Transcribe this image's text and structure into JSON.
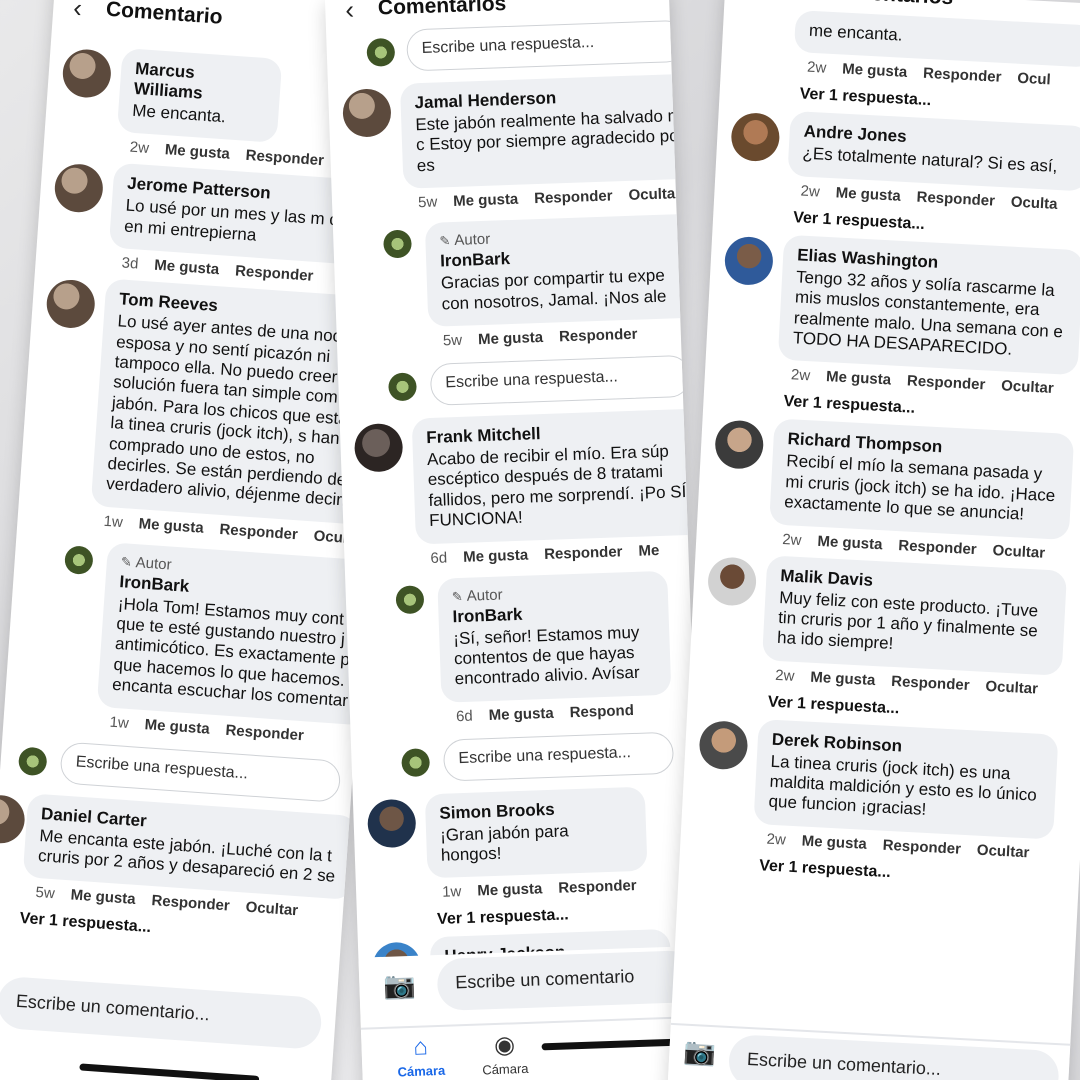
{
  "panel1": {
    "title": "Comentario",
    "comments": [
      {
        "name": "Marcus Williams",
        "text": "Me encanta.",
        "time": "2w",
        "like": "Me gusta",
        "reply": "Responder"
      },
      {
        "name": "Jerome Patterson",
        "text": "Lo usé por un mes y las m oscuras en mi entrepierna",
        "time": "3d",
        "like": "Me gusta",
        "reply": "Responder"
      },
      {
        "name": "Tom Reeves",
        "text": "Lo usé ayer antes de una noc esposa y no sentí picazón ni tampoco ella. No puedo creer solución fuera tan simple com jabón. Para los chicos que esta con la tinea cruris (jock itch), s han comprado uno de estos, no decirles. Se están perdiendo de verdadero alivio, déjenme decirl",
        "time": "1w",
        "like": "Me gusta",
        "reply": "Responder",
        "hide": "Ocult"
      }
    ],
    "author_reply": {
      "badge": "Autor",
      "name": "IronBark",
      "text": "¡Hola Tom! Estamos muy cont que te esté gustando nuestro j antimicótico. Es exactamente p que hacemos lo que hacemos. encanta escuchar los comentar",
      "time": "1w",
      "like": "Me gusta",
      "reply": "Responder"
    },
    "reply_placeholder": "Escribe una respuesta...",
    "last_comment": {
      "name": "Daniel Carter",
      "text": "Me encanta este jabón. ¡Luché con la t cruris por 2 años y desapareció en 2 se",
      "time": "5w",
      "like": "Me gusta",
      "reply": "Responder",
      "hide": "Ocultar"
    },
    "view_reply": "Ver 1 respuesta...",
    "comment_placeholder": "Escribe un comentario..."
  },
  "panel2": {
    "title": "Comentarios",
    "reply_placeholder": "Escribe una respuesta...",
    "comments": [
      {
        "name": "Jamal Henderson",
        "text": "Este jabón realmente ha salvado mi c Estoy por siempre agradecido por es",
        "time": "5w",
        "like": "Me gusta",
        "reply": "Responder",
        "hide": "Ocultar"
      },
      {
        "name": "Frank Mitchell",
        "text": "Acabo de recibir el mío. Era súp escéptico después de 8 tratami fallidos, pero me sorprendí. ¡Po SÍ FUNCIONA!",
        "time": "6d",
        "like": "Me gusta",
        "reply": "Responder",
        "hide": "Me"
      },
      {
        "name": "Simon Brooks",
        "text": "¡Gran jabón para hongos!",
        "time": "1w",
        "like": "Me gusta",
        "reply": "Responder"
      },
      {
        "name": "Henry Jackson",
        "text": ""
      }
    ],
    "author_replies": [
      {
        "badge": "Autor",
        "name": "IronBark",
        "text": "Gracias por compartir tu expe con nosotros, Jamal. ¡Nos ale",
        "time": "5w",
        "like": "Me gusta",
        "reply": "Responder"
      },
      {
        "badge": "Autor",
        "name": "IronBark",
        "text": "¡Sí, señor! Estamos muy contentos de que hayas encontrado alivio. Avísar",
        "time": "6d",
        "like": "Me gusta",
        "reply": "Respond"
      }
    ],
    "view_reply": "Ver 1 respuesta...",
    "comment_placeholder": "Escribe un comentario",
    "tabs": [
      {
        "label": "Cámara",
        "icon": "home-icon"
      },
      {
        "label": "Cámara",
        "icon": "profile-icon"
      }
    ]
  },
  "panel3": {
    "title": "Comentarios",
    "top_text": "me encanta.",
    "top_time": "2w",
    "top_like": "Me gusta",
    "top_reply": "Responder",
    "top_hide": "Ocul",
    "view_reply": "Ver 1 respuesta...",
    "comments": [
      {
        "name": "Andre Jones",
        "text": "¿Es totalmente natural? Si es así,",
        "time": "2w",
        "like": "Me gusta",
        "reply": "Responder",
        "hide": "Oculta"
      },
      {
        "name": "Elias Washington",
        "text": "Tengo 32 años y solía rascarme la mis muslos constantemente, era realmente malo. Una semana con e TODO HA DESAPARECIDO.",
        "time": "2w",
        "like": "Me gusta",
        "reply": "Responder",
        "hide": "Ocultar"
      },
      {
        "name": "Richard Thompson",
        "text": "Recibí el mío la semana pasada y mi cruris (jock itch) se ha ido. ¡Hace exactamente lo que se anuncia!",
        "time": "2w",
        "like": "Me gusta",
        "reply": "Responder",
        "hide": "Ocultar"
      },
      {
        "name": "Malik Davis",
        "text": "Muy feliz con este producto. ¡Tuve tin cruris por 1 año y finalmente se ha ido siempre!",
        "time": "2w",
        "like": "Me gusta",
        "reply": "Responder",
        "hide": "Ocultar"
      },
      {
        "name": "Derek Robinson",
        "text": "La tinea cruris (jock itch) es una maldita maldición y esto es lo único que funcion ¡gracias!",
        "time": "2w",
        "like": "Me gusta",
        "reply": "Responder",
        "hide": "Ocultar"
      }
    ],
    "comment_placeholder": "Escribe un comentario..."
  }
}
